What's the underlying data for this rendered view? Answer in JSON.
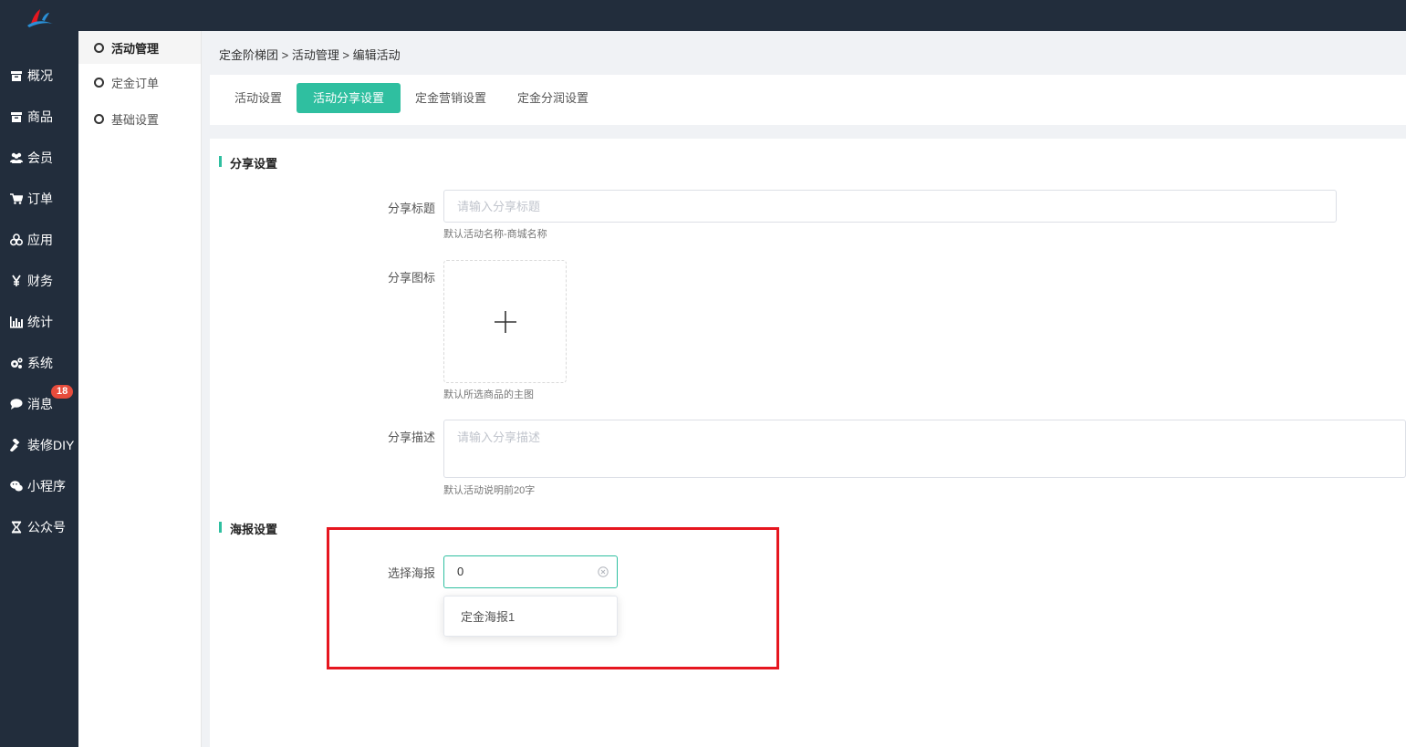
{
  "sidebar": {
    "items": [
      {
        "label": "概况",
        "icon": "archive-icon"
      },
      {
        "label": "商品",
        "icon": "archive-icon"
      },
      {
        "label": "会员",
        "icon": "users-icon"
      },
      {
        "label": "订单",
        "icon": "cart-icon"
      },
      {
        "label": "应用",
        "icon": "cubes-icon"
      },
      {
        "label": "财务",
        "icon": "yen-icon"
      },
      {
        "label": "统计",
        "icon": "bar-chart-icon"
      },
      {
        "label": "系统",
        "icon": "gears-icon"
      },
      {
        "label": "消息",
        "icon": "chat-icon",
        "badge": "18"
      },
      {
        "label": "装修DIY",
        "icon": "gavel-icon"
      },
      {
        "label": "小程序",
        "icon": "wechat-icon"
      },
      {
        "label": "公众号",
        "icon": "hourglass-icon"
      }
    ]
  },
  "subnav": {
    "items": [
      {
        "label": "活动管理"
      },
      {
        "label": "定金订单"
      },
      {
        "label": "基础设置"
      }
    ]
  },
  "breadcrumb": {
    "text": "定金阶梯团 > 活动管理 > 编辑活动"
  },
  "tabs": [
    {
      "label": "活动设置"
    },
    {
      "label": "活动分享设置"
    },
    {
      "label": "定金营销设置"
    },
    {
      "label": "定金分润设置"
    }
  ],
  "share": {
    "section_title": "分享设置",
    "title_label": "分享标题",
    "title_placeholder": "请输入分享标题",
    "title_hint": "默认活动名称-商城名称",
    "icon_label": "分享图标",
    "icon_hint": "默认所选商品的主图",
    "desc_label": "分享描述",
    "desc_placeholder": "请输入分享描述",
    "desc_hint": "默认活动说明前20字"
  },
  "poster": {
    "section_title": "海报设置",
    "select_label": "选择海报",
    "select_value": "0",
    "options": [
      "定金海报1"
    ]
  },
  "colors": {
    "accent": "#2fbfa0",
    "sidebar_bg": "#222d3c",
    "highlight": "#e6161f",
    "badge": "#e74c3c"
  }
}
